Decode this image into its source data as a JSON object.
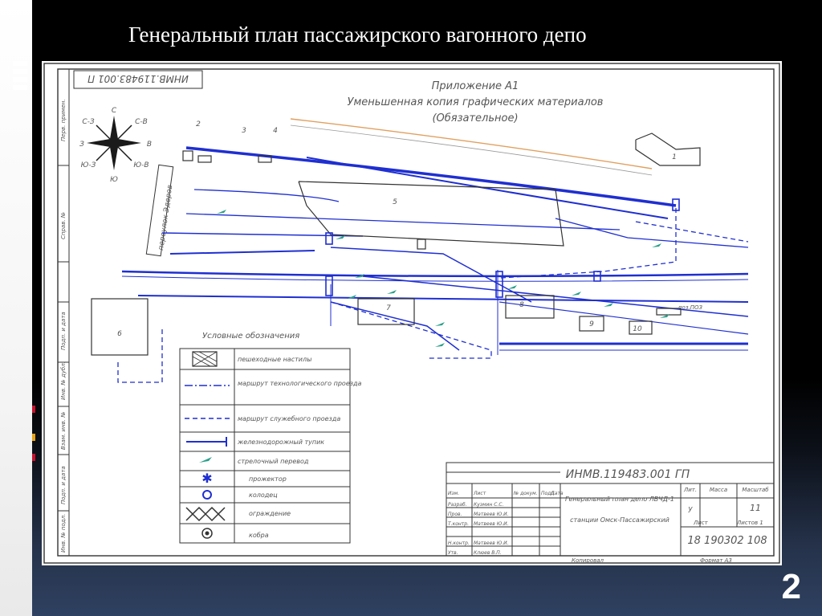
{
  "slide": {
    "title": "Генеральный план пассажирского вагонного депо",
    "number": "2"
  },
  "drawing": {
    "header": {
      "line1": "Приложение А1",
      "line2": "Уменьшенная копия графических материалов",
      "line3": "(Обязательное)"
    },
    "stamp_code_vertical": "ИНМВ.119483.001 П",
    "compass": {
      "n": "С",
      "s": "Ю",
      "e": "В",
      "w": "З",
      "ne": "С-В",
      "nw": "С-З",
      "se": "Ю-В",
      "sw": "Ю-З"
    },
    "street_label": "переулок Эдеров",
    "building_numbers": [
      "1",
      "2",
      "3",
      "4",
      "5",
      "6",
      "7",
      "8",
      "9",
      "10"
    ],
    "small_label": "поз.ПОЗ",
    "legend": {
      "title": "Условные обозначения",
      "rows": [
        "пешеходные настилы",
        "маршрут технологического проезда",
        "маршрут служебного проезда",
        "железнодорожный тупик",
        "стрелочный перевод",
        "прожектор",
        "колодец",
        "ограждение",
        "кобра"
      ]
    },
    "title_block": {
      "code": "ИНМВ.119483.001 ГП",
      "description_line1": "Генеральный план депо ЛВЧД-1",
      "description_line2": "станции Омск-Пассажирский",
      "headers": [
        "Лит.",
        "Масса",
        "Масштаб"
      ],
      "lit_value": "у",
      "scale_value": "11",
      "sheet_label": "Лист",
      "sheets_label": "Листов 1",
      "group": "18 190302 108",
      "copied": "Копировал",
      "format": "Формат А3",
      "signature_rows": [
        [
          "Изм.",
          "Лист",
          "№ докум.",
          "Подп.",
          "Дата"
        ],
        [
          "Разраб.",
          "Кузмин С.С."
        ],
        [
          "Пров.",
          "Матвеев Ю.И."
        ],
        [
          "Т.контр.",
          "Матвеев Ю.И."
        ],
        [
          "Н.контр.",
          "Матвеев Ю.И."
        ],
        [
          "Утв.",
          "Клюев В.П."
        ]
      ]
    },
    "side_stamps": [
      "Перв. примен.",
      "Справ. №",
      "Подп. и дата",
      "Инв. № дубл.",
      "Взам. инв. №",
      "Подп. и дата",
      "Инв. № подл."
    ]
  }
}
